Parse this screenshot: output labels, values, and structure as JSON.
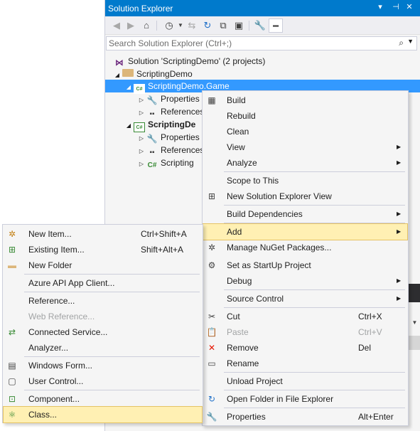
{
  "solution_explorer": {
    "title": "Solution Explorer",
    "title_buttons": [
      "▾",
      "⊣",
      "✕"
    ],
    "search_placeholder": "Search Solution Explorer (Ctrl+;)",
    "tree": {
      "solution": "Solution 'ScriptingDemo' (2 projects)",
      "folder": "ScriptingDemo",
      "project_game": "ScriptingDemo.Game",
      "game_properties": "Properties",
      "game_references": "References",
      "project_two": "ScriptingDe",
      "two_properties": "Properties",
      "two_references": "References",
      "two_file": "Scripting"
    }
  },
  "context_menu": {
    "build": "Build",
    "rebuild": "Rebuild",
    "clean": "Clean",
    "view": "View",
    "analyze": "Analyze",
    "scope_to_this": "Scope to This",
    "new_se_view": "New Solution Explorer View",
    "build_dependencies": "Build Dependencies",
    "add": "Add",
    "manage_nuget": "Manage NuGet Packages...",
    "set_startup": "Set as StartUp Project",
    "debug": "Debug",
    "source_control": "Source Control",
    "cut": "Cut",
    "cut_shortcut": "Ctrl+X",
    "paste": "Paste",
    "paste_shortcut": "Ctrl+V",
    "remove": "Remove",
    "remove_shortcut": "Del",
    "rename": "Rename",
    "unload_project": "Unload Project",
    "open_folder": "Open Folder in File Explorer",
    "properties": "Properties",
    "properties_shortcut": "Alt+Enter"
  },
  "add_submenu": {
    "new_item": "New Item...",
    "new_item_shortcut": "Ctrl+Shift+A",
    "existing_item": "Existing Item...",
    "existing_item_shortcut": "Shift+Alt+A",
    "new_folder": "New Folder",
    "azure_api": "Azure API App Client...",
    "reference": "Reference...",
    "web_reference": "Web Reference...",
    "connected_service": "Connected Service...",
    "analyzer": "Analyzer...",
    "windows_form": "Windows Form...",
    "user_control": "User Control...",
    "component": "Component...",
    "class": "Class..."
  },
  "colors": {
    "title_bar": "#007acc",
    "selection": "#3399ff",
    "menu_highlight": "#fff0b3",
    "menu_bg": "#f5f5f5"
  }
}
